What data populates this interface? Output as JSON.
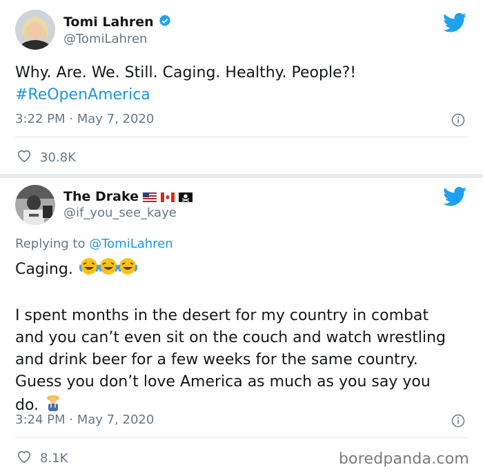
{
  "tweet1": {
    "name": "Tomi Lahren",
    "handle": "@TomiLahren",
    "text": "Why. Are. We. Still. Caging. Healthy. People?!",
    "hashtag": "#ReOpenAmerica",
    "timestamp": "3:22 PM · May 7, 2020",
    "likes": "30.8K"
  },
  "tweet2": {
    "name": "The Drake",
    "handle": "@if_you_see_kaye",
    "reply_prefix": "Replying to",
    "reply_to": "@TomiLahren",
    "line1": "Caging.",
    "body": "I spent months in the desert for my country in combat and you can’t even sit on the couch and watch wrestling and drink beer for a few weeks for the same country. Guess you don’t love America as much as you say you do.",
    "timestamp": "3:24 PM · May 7, 2020",
    "likes": "8.1K"
  },
  "watermark": "boredpanda.com",
  "colors": {
    "link": "#1b95e0",
    "twitter_blue": "#1da1f2",
    "secondary_text": "#657786",
    "verified": "#1da1f2"
  }
}
